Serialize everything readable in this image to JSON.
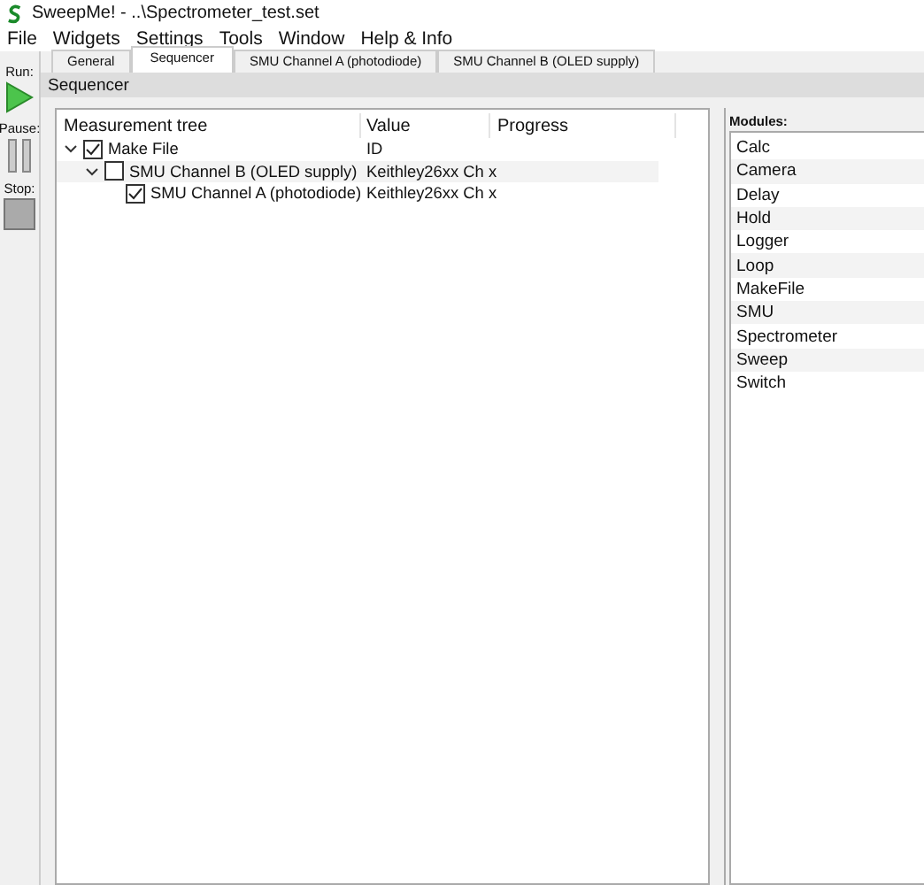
{
  "window": {
    "title": "SweepMe! - ..\\Spectrometer_test.set"
  },
  "menu": [
    "File",
    "Widgets",
    "Settings",
    "Tools",
    "Window",
    "Help & Info"
  ],
  "toolbar": {
    "run": "Run:",
    "pause": "Pause:",
    "stop": "Stop:"
  },
  "tabs": [
    {
      "label": "General",
      "selected": false
    },
    {
      "label": "Sequencer",
      "selected": true
    },
    {
      "label": "SMU Channel A (photodiode)",
      "selected": false
    },
    {
      "label": "SMU Channel B (OLED supply)",
      "selected": false
    }
  ],
  "section_title": "Sequencer",
  "tree": {
    "columns": [
      "Measurement tree",
      "Value",
      "Progress"
    ],
    "items": [
      {
        "name": "Make File",
        "value": "ID",
        "checked": true,
        "expanded": true,
        "children": [
          {
            "name": "SMU Channel B (OLED supply)",
            "value": "Keithley26xx Ch x",
            "checked": false,
            "expanded": true,
            "children": [
              {
                "name": "SMU Channel A (photodiode)",
                "value": "Keithley26xx Ch x",
                "checked": true
              }
            ]
          }
        ]
      }
    ]
  },
  "modules": {
    "title": "Modules:",
    "items": [
      "Calc",
      "Camera",
      "Delay",
      "Hold",
      "Logger",
      "Loop",
      "MakeFile",
      "SMU",
      "Spectrometer",
      "Sweep",
      "Switch"
    ]
  }
}
